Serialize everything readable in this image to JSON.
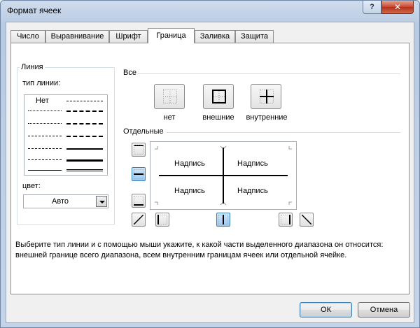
{
  "window": {
    "title": "Формат ячеек",
    "help_label": "?",
    "close_label": "✕"
  },
  "tabs": [
    {
      "label": "Число",
      "active": false
    },
    {
      "label": "Выравнивание",
      "active": false
    },
    {
      "label": "Шрифт",
      "active": false
    },
    {
      "label": "Граница",
      "active": true
    },
    {
      "label": "Заливка",
      "active": false
    },
    {
      "label": "Защита",
      "active": false
    }
  ],
  "line_group": {
    "title": "Линия",
    "style_label": "тип линии:",
    "none_label": "Нет",
    "color_label": "цвет:",
    "color_value": "Авто"
  },
  "presets": {
    "title": "Все",
    "none_label": "нет",
    "outline_label": "внешние",
    "inside_label": "внутренние"
  },
  "border": {
    "title": "Отдельные",
    "preview_text": "Надпись"
  },
  "description": "Выберите тип линии и с помощью мыши укажите, к какой части выделенного диапазона он относится: внешней границе всего диапазона, всем внутренним границам ячеек или отдельной ячейке.",
  "buttons": {
    "ok": "ОК",
    "cancel": "Отмена"
  }
}
